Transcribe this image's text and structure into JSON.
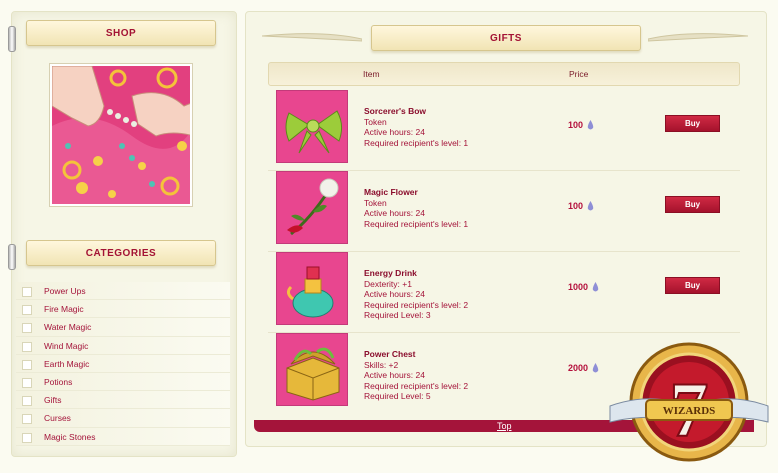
{
  "shop": {
    "title": "SHOP"
  },
  "categories": {
    "title": "CATEGORIES",
    "items": [
      "Power Ups",
      "Fire Magic",
      "Water Magic",
      "Wind Magic",
      "Earth Magic",
      "Potions",
      "Gifts",
      "Curses",
      "Magic Stones"
    ]
  },
  "gifts": {
    "title": "GIFTS",
    "columns": {
      "item": "Item",
      "price": "Price"
    },
    "buy_label": "Buy",
    "products": [
      {
        "name": "Sorcerer's Bow",
        "lines": [
          "Token",
          "Active hours: 24",
          "Required recipient's level: 1"
        ],
        "price": "100",
        "icon": "bow-icon"
      },
      {
        "name": "Magic Flower",
        "lines": [
          "Token",
          "Active hours: 24",
          "Required recipient's level: 1"
        ],
        "price": "100",
        "icon": "flower-icon"
      },
      {
        "name": "Energy Drink",
        "lines": [
          "Dexterity: +1",
          "Active hours: 24",
          "Required recipient's level: 2",
          "Required Level: 3"
        ],
        "price": "1000",
        "icon": "potion-bottle-icon"
      },
      {
        "name": "Power Chest",
        "lines": [
          "Skills: +2",
          "Active hours: 24",
          "Required recipient's level: 2",
          "Required Level: 5"
        ],
        "price": "2000",
        "icon": "treasure-chest-icon"
      }
    ],
    "footer": {
      "top_link": "Top"
    }
  },
  "logo": {
    "text": "WIZARDS",
    "numeral": "7"
  },
  "colors": {
    "accent": "#a4143a",
    "buy_button": "#c01f3a",
    "background": "#f6f6e6",
    "currency_drop": "#8f8fd6"
  }
}
